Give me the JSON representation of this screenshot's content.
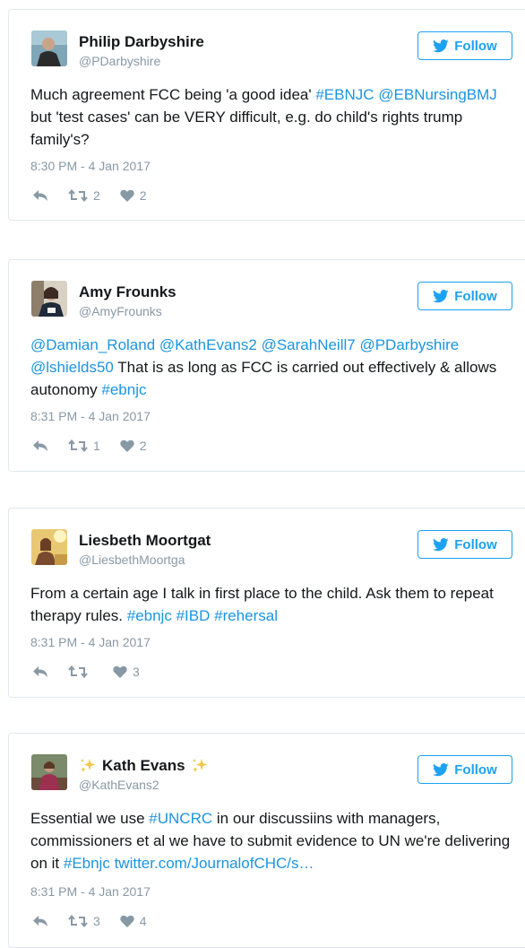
{
  "follow_label": "Follow",
  "colors": {
    "link": "#1b95e0",
    "follow_accent": "#1da1f2",
    "muted": "#8899a6",
    "border": "#e1e8ed"
  },
  "tweets": [
    {
      "name": "Philip Darbyshire",
      "handle": "@PDarbyshire",
      "text": [
        {
          "t": "Much agreement FCC being 'a good idea' ",
          "link": false
        },
        {
          "t": "#EBNJC",
          "link": true
        },
        {
          "t": " ",
          "link": false
        },
        {
          "t": "@EBNursingBMJ",
          "link": true
        },
        {
          "t": " but 'test cases' can be VERY difficult, e.g. do child's rights trump family's?",
          "link": false
        }
      ],
      "timestamp": "8:30 PM - 4 Jan 2017",
      "retweets": "2",
      "likes": "2"
    },
    {
      "name": "Amy Frounks",
      "handle": "@AmyFrounks",
      "text": [
        {
          "t": "@Damian_Roland",
          "link": true
        },
        {
          "t": " ",
          "link": false
        },
        {
          "t": "@KathEvans2",
          "link": true
        },
        {
          "t": " ",
          "link": false
        },
        {
          "t": "@SarahNeill7",
          "link": true
        },
        {
          "t": " ",
          "link": false
        },
        {
          "t": "@PDarbyshire",
          "link": true
        },
        {
          "t": " ",
          "link": false
        },
        {
          "t": "@lshields50",
          "link": true
        },
        {
          "t": " That is as long as FCC is carried out effectively & allows autonomy ",
          "link": false
        },
        {
          "t": "#ebnjc",
          "link": true
        }
      ],
      "timestamp": "8:31 PM - 4 Jan 2017",
      "retweets": "1",
      "likes": "2"
    },
    {
      "name": "Liesbeth Moortgat",
      "handle": "@LiesbethMoortga",
      "text": [
        {
          "t": "From a certain age I talk in first place to the child. Ask them to repeat therapy rules. ",
          "link": false
        },
        {
          "t": "#ebnjc",
          "link": true
        },
        {
          "t": " ",
          "link": false
        },
        {
          "t": "#IBD",
          "link": true
        },
        {
          "t": " ",
          "link": false
        },
        {
          "t": "#rehersal",
          "link": true
        }
      ],
      "timestamp": "8:31 PM - 4 Jan 2017",
      "retweets": "",
      "likes": "3"
    },
    {
      "name": "Kath Evans",
      "handle": "@KathEvans2",
      "name_decoration": "sparkles-icon",
      "text": [
        {
          "t": "Essential we use ",
          "link": false
        },
        {
          "t": "#UNCRC",
          "link": true
        },
        {
          "t": " in our discussiins with managers, commissioners et al we have to submit evidence to UN we're delivering on it ",
          "link": false
        },
        {
          "t": "#Ebnjc",
          "link": true
        },
        {
          "t": " ",
          "link": false
        },
        {
          "t": "twitter.com/JournalofCHC/s…",
          "link": true
        }
      ],
      "timestamp": "8:31 PM - 4 Jan 2017",
      "retweets": "3",
      "likes": "4"
    }
  ]
}
